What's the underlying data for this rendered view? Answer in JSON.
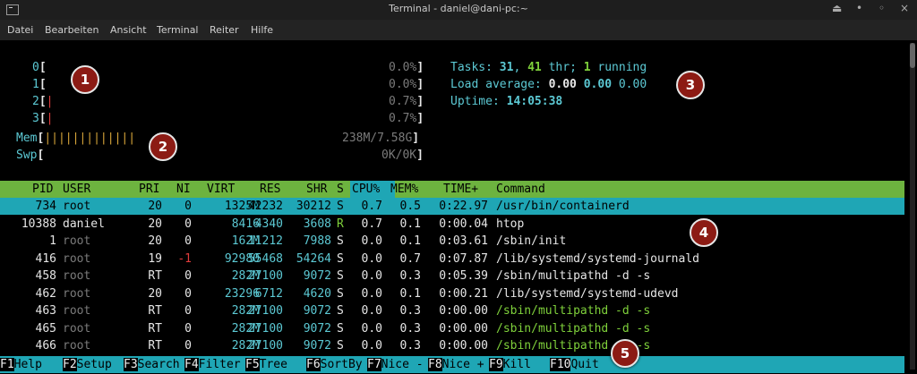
{
  "window": {
    "title": "Terminal - daniel@dani-pc:~"
  },
  "menu": [
    "Datei",
    "Bearbeiten",
    "Ansicht",
    "Terminal",
    "Reiter",
    "Hilfe"
  ],
  "meters": [
    {
      "label": "0",
      "pct": "0.0%"
    },
    {
      "label": "1",
      "pct": "0.0%"
    },
    {
      "label": "2",
      "pct": "0.7%"
    },
    {
      "label": "3",
      "pct": "0.7%"
    }
  ],
  "mem": {
    "label": "Mem",
    "value": "238M/7.58G",
    "bars": "|||||||||||||"
  },
  "swp": {
    "label": "Swp",
    "value": "0K/0K"
  },
  "summary": {
    "tasks_label": "Tasks:",
    "tasks": "31",
    "thr": "41",
    "thr_label": "thr;",
    "running": "1",
    "running_label": "running",
    "load_label": "Load average:",
    "load1": "0.00",
    "load5": "0.00",
    "load15": "0.00",
    "uptime_label": "Uptime:",
    "uptime": "14:05:38"
  },
  "columns": [
    "PID",
    "USER",
    "PRI",
    "NI",
    "VIRT",
    "RES",
    "SHR",
    "S",
    "CPU%",
    "MEM%",
    "TIME+",
    "Command"
  ],
  "processes": [
    {
      "pid": "734",
      "user": "root",
      "pri": "20",
      "ni": "0",
      "virt": "1325M",
      "res": "42232",
      "shr": "30212",
      "s": "S",
      "cpu": "0.7",
      "mem": "0.5",
      "time": "0:22.97",
      "cmd": "/usr/bin/containerd"
    },
    {
      "pid": "10388",
      "user": "daniel",
      "pri": "20",
      "ni": "0",
      "virt": "8416",
      "res": "4340",
      "shr": "3608",
      "s": "R",
      "cpu": "0.7",
      "mem": "0.1",
      "time": "0:00.04",
      "cmd": "htop"
    },
    {
      "pid": "1",
      "user": "root",
      "pri": "20",
      "ni": "0",
      "virt": "162M",
      "res": "11212",
      "shr": "7988",
      "s": "S",
      "cpu": "0.0",
      "mem": "0.1",
      "time": "0:03.61",
      "cmd": "/sbin/init"
    },
    {
      "pid": "416",
      "user": "root",
      "pri": "19",
      "ni": "-1",
      "virt": "92980",
      "res": "55468",
      "shr": "54264",
      "s": "S",
      "cpu": "0.0",
      "mem": "0.7",
      "time": "0:07.87",
      "cmd": "/lib/systemd/systemd-journald"
    },
    {
      "pid": "458",
      "user": "root",
      "pri": "RT",
      "ni": "0",
      "virt": "282M",
      "res": "27100",
      "shr": "9072",
      "s": "S",
      "cpu": "0.0",
      "mem": "0.3",
      "time": "0:05.39",
      "cmd": "/sbin/multipathd -d -s"
    },
    {
      "pid": "462",
      "user": "root",
      "pri": "20",
      "ni": "0",
      "virt": "23296",
      "res": "6712",
      "shr": "4620",
      "s": "S",
      "cpu": "0.0",
      "mem": "0.1",
      "time": "0:00.21",
      "cmd": "/lib/systemd/systemd-udevd"
    },
    {
      "pid": "463",
      "user": "root",
      "pri": "RT",
      "ni": "0",
      "virt": "282M",
      "res": "27100",
      "shr": "9072",
      "s": "S",
      "cpu": "0.0",
      "mem": "0.3",
      "time": "0:00.00",
      "cmd": "/sbin/multipathd -d -s"
    },
    {
      "pid": "465",
      "user": "root",
      "pri": "RT",
      "ni": "0",
      "virt": "282M",
      "res": "27100",
      "shr": "9072",
      "s": "S",
      "cpu": "0.0",
      "mem": "0.3",
      "time": "0:00.00",
      "cmd": "/sbin/multipathd -d -s"
    },
    {
      "pid": "466",
      "user": "root",
      "pri": "RT",
      "ni": "0",
      "virt": "282M",
      "res": "27100",
      "shr": "9072",
      "s": "S",
      "cpu": "0.0",
      "mem": "0.3",
      "time": "0:00.00",
      "cmd": "/sbin/multipathd -d -s"
    }
  ],
  "fkeys": [
    {
      "key": "F1",
      "label": "Help"
    },
    {
      "key": "F2",
      "label": "Setup"
    },
    {
      "key": "F3",
      "label": "Search"
    },
    {
      "key": "F4",
      "label": "Filter"
    },
    {
      "key": "F5",
      "label": "Tree"
    },
    {
      "key": "F6",
      "label": "SortBy"
    },
    {
      "key": "F7",
      "label": "Nice -"
    },
    {
      "key": "F8",
      "label": "Nice +"
    },
    {
      "key": "F9",
      "label": "Kill"
    },
    {
      "key": "F10",
      "label": "Quit"
    }
  ],
  "badges": [
    "1",
    "2",
    "3",
    "4",
    "5"
  ],
  "colors": {
    "header": "#6db33f",
    "selected": "#1fa6b5",
    "badge": "#8c1b14"
  }
}
